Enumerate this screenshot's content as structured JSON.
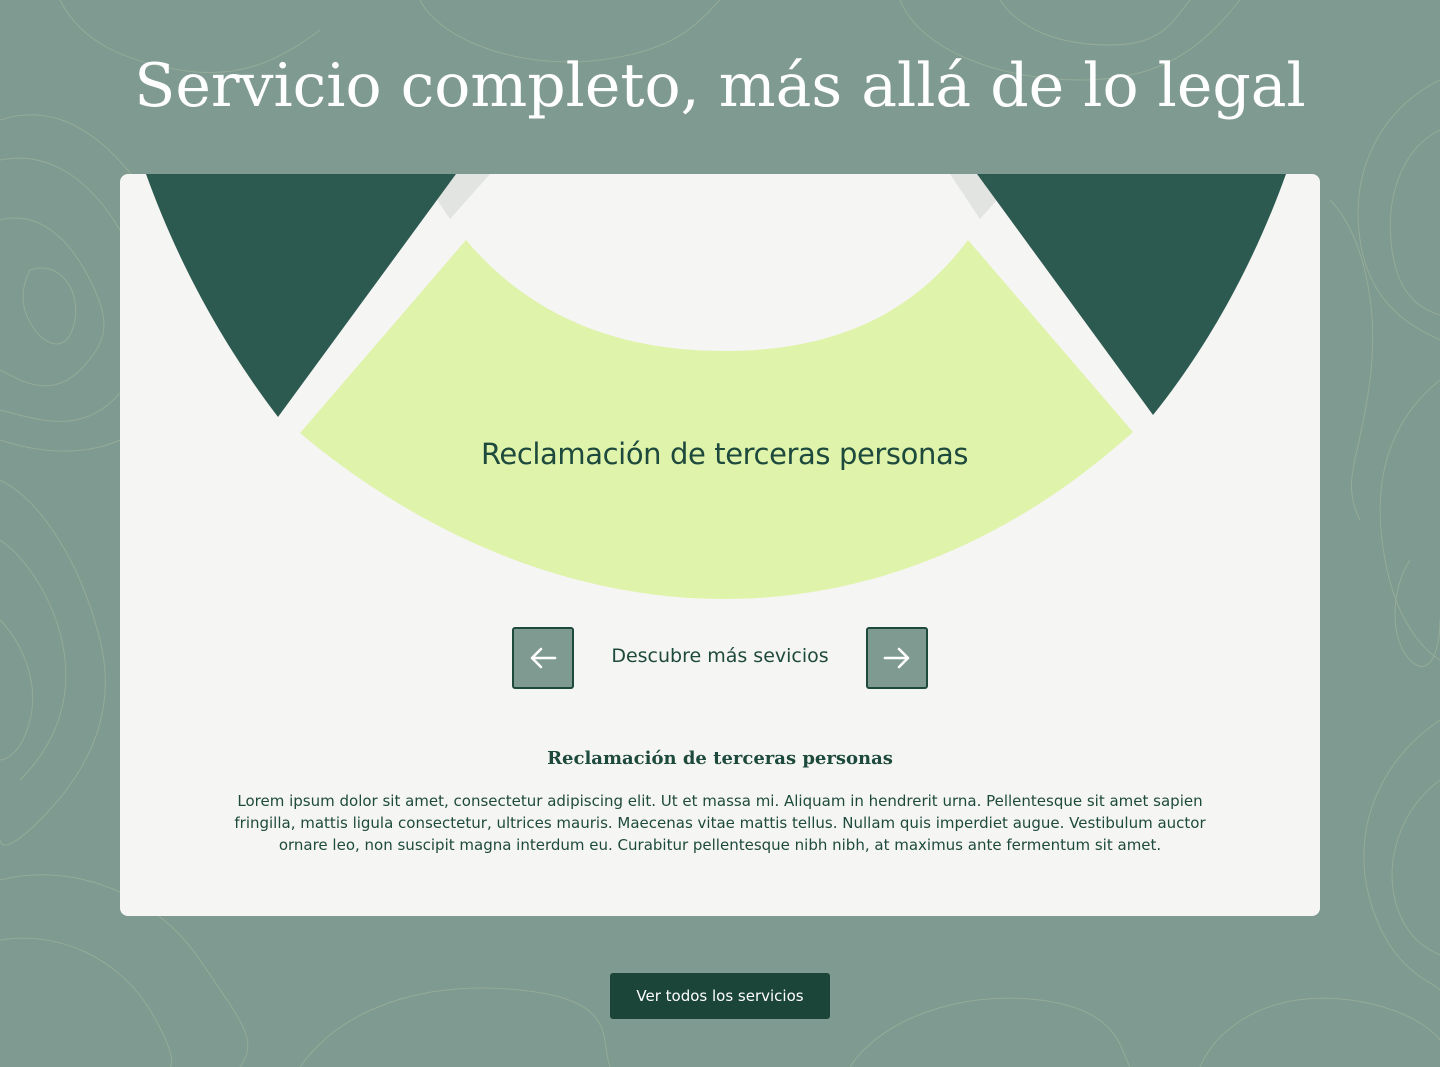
{
  "page": {
    "title": "Servicio completo, más allá de lo legal"
  },
  "carousel": {
    "active_segment_label": "Reclamación de terceras personas",
    "nav_label": "Descubre más sevicios",
    "prev_icon": "arrow-left-icon",
    "next_icon": "arrow-right-icon"
  },
  "description": {
    "title": "Reclamación de terceras personas",
    "text": "Lorem ipsum dolor sit amet, consectetur adipiscing elit. Ut et massa mi. Aliquam in hendrerit urna. Pellentesque sit amet sapien fringilla, mattis ligula consectetur, ultrices mauris. Maecenas vitae mattis tellus. Nullam quis imperdiet augue. Vestibulum auctor ornare leo, non suscipit magna interdum eu. Curabitur pellentesque nibh nibh, at maximus ante fermentum sit amet."
  },
  "cta": {
    "label": "Ver todos los servicios"
  },
  "colors": {
    "background": "#7f9a91",
    "card": "#f5f5f3",
    "dark_green": "#2d5a50",
    "active_segment": "#e0f3ab",
    "text_dark": "#1e4a3d",
    "button": "#1b4539"
  }
}
